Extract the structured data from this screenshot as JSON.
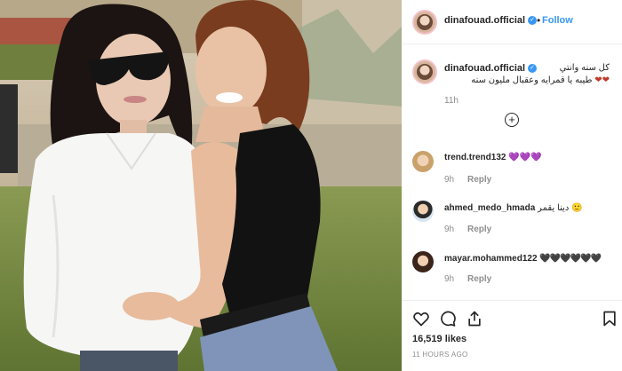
{
  "header": {
    "username": "dinafouad.official",
    "separator": "•",
    "follow_label": "Follow"
  },
  "caption": {
    "username": "dinafouad.official",
    "line1": "كل سنه وانتي",
    "line2": "طيبه يا قمرايه وعقبال مليون سنه",
    "hearts": "❤❤",
    "time": "11h"
  },
  "load_more_icon": "plus-circle-icon",
  "comments": [
    {
      "username": "trend.trend132",
      "text": "💜💜💜",
      "time": "9h",
      "reply_label": "Reply"
    },
    {
      "username": "ahmed_medo_hmada",
      "text": "دينا يقمر 🙂",
      "time": "9h",
      "reply_label": "Reply"
    },
    {
      "username": "mayar.mohammed122",
      "text": "🖤🖤🖤🖤🖤🖤",
      "time": "9h",
      "reply_label": "Reply"
    }
  ],
  "actions": {
    "icons": [
      "heart-icon",
      "comment-icon",
      "share-icon",
      "bookmark-icon"
    ],
    "likes": "16,519 likes",
    "posted": "11 HOURS AGO"
  },
  "colors": {
    "link": "#3897f0",
    "muted": "#8e8e8e",
    "text": "#262626"
  }
}
